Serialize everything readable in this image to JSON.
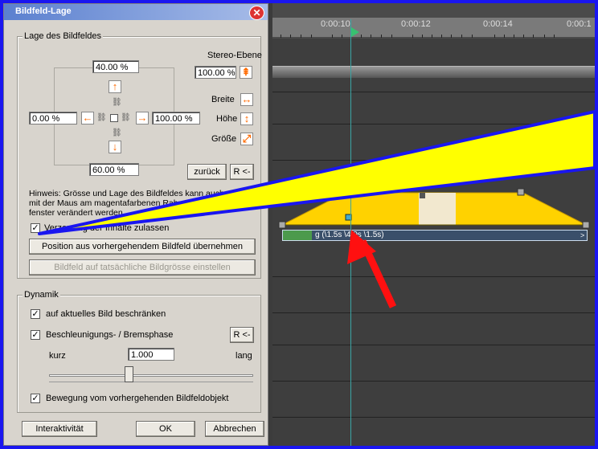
{
  "dialog": {
    "title": "Bildfeld-Lage",
    "group1": "Lage des Bildfeldes",
    "stereo_label": "Stereo-Ebene",
    "stereo_value": "100.00 %",
    "top_value": "40.00 %",
    "left_value": "0.00 %",
    "right_value": "100.00 %",
    "bottom_value": "60.00 %",
    "breite_label": "Breite",
    "hoehe_label": "Höhe",
    "groesse_label": "Größe",
    "zurueck": "zurück",
    "r_btn": "R <-",
    "hint_line1": "Hinweis: Grösse und Lage des Bildfeldes kann auch visuell",
    "hint_line2": "mit der Maus am magentafarbenen Rahmen im",
    "hint_line3": "fenster verändert werden.",
    "checkbox_distort": "Verzerrung der Inhalte zulassen",
    "btn_position": "Position aus vorhergehendem Bildfeld übernehmen",
    "btn_actual_size": "Bildfeld auf tatsächliche Bildgrösse einstellen",
    "group2": "Dynamik",
    "chk_limit": "auf aktuelles Bild beschränken",
    "chk_accel": "Beschleunigungs- / Bremsphase",
    "r_btn2": "R <-",
    "kurz": "kurz",
    "lang": "lang",
    "accel_value": "1.000",
    "chk_motion": "Bewegung vom vorhergehenden Bildfeldobjekt",
    "btn_interactive": "Interaktivität",
    "btn_ok": "OK",
    "btn_cancel": "Abbrechen"
  },
  "timeline": {
    "ticks": [
      "0:00:10",
      "0:00:12",
      "0:00:14",
      "0:00:1"
    ],
    "track_text": "g (\\1.5s \\4.0s \\1.5s)",
    "track_end": ">"
  },
  "colors": {
    "accent_orange": "#ff6a00",
    "track_yellow": "#ffd200",
    "pointer_red": "#ff1010",
    "frame_blue": "#1a16f0"
  }
}
